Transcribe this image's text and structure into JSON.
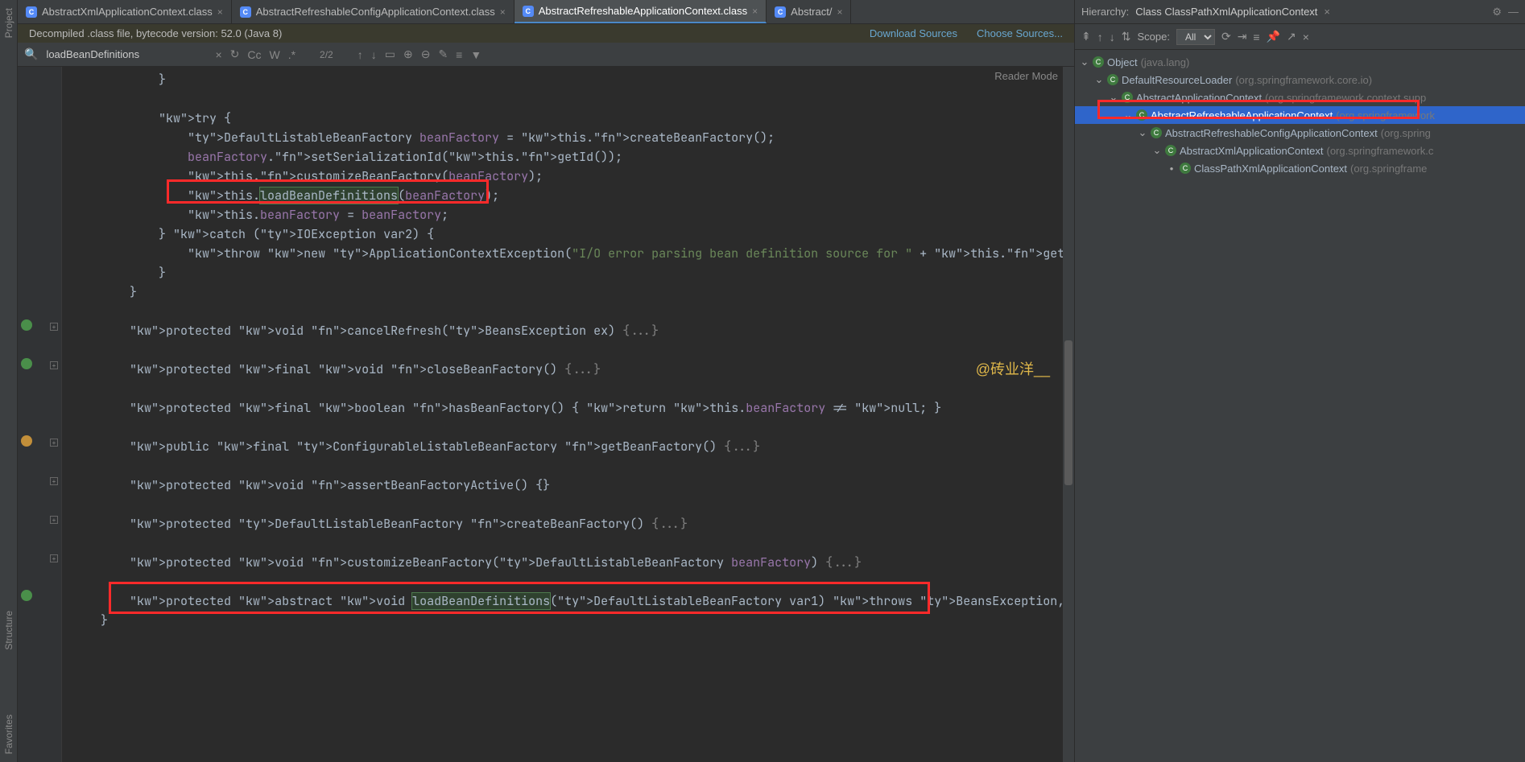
{
  "tabs": [
    {
      "label": "AbstractXmlApplicationContext.class",
      "active": false
    },
    {
      "label": "AbstractRefreshableConfigApplicationContext.class",
      "active": false
    },
    {
      "label": "AbstractRefreshableApplicationContext.class",
      "active": true
    },
    {
      "label": "Abstract/",
      "active": false
    }
  ],
  "banner": {
    "text": "Decompiled .class file, bytecode version: 52.0 (Java 8)",
    "link_download": "Download Sources",
    "link_choose": "Choose Sources..."
  },
  "find": {
    "value": "loadBeanDefinitions",
    "count": "2/2",
    "opts": {
      "cc": "Cc",
      "w": "W",
      "regex": ".*"
    }
  },
  "reader_mode": "Reader Mode",
  "watermark": "@砖业洋__",
  "code_lines": [
    "            }",
    "",
    "            try {",
    "                DefaultListableBeanFactory beanFactory = this.createBeanFactory();",
    "                beanFactory.setSerializationId(this.getId());",
    "                this.customizeBeanFactory(beanFactory);",
    "                this.loadBeanDefinitions(beanFactory);",
    "                this.beanFactory = beanFactory;",
    "            } catch (IOException var2) {",
    "                throw new ApplicationContextException(\"I/O error parsing bean definition source for \" + this.getDispl",
    "            }",
    "        }",
    "",
    "        protected void cancelRefresh(BeansException ex) {...}",
    "",
    "        protected final void closeBeanFactory() {...}",
    "",
    "        protected final boolean hasBeanFactory() { return this.beanFactory != null; }",
    "",
    "        public final ConfigurableListableBeanFactory getBeanFactory() {...}",
    "",
    "        protected void assertBeanFactoryActive() {}",
    "",
    "        protected DefaultListableBeanFactory createBeanFactory() {...}",
    "",
    "        protected void customizeBeanFactory(DefaultListableBeanFactory beanFactory) {...}",
    "",
    "        protected abstract void loadBeanDefinitions(DefaultListableBeanFactory var1) throws BeansException, IOExcepti",
    "    }"
  ],
  "hierarchy": {
    "title": "Hierarchy:",
    "class": "Class ClassPathXmlApplicationContext",
    "scope_label": "Scope:",
    "scope_value": "All",
    "tree": [
      {
        "indent": 0,
        "name": "Object",
        "pkg": "(java.lang)",
        "selected": false
      },
      {
        "indent": 1,
        "name": "DefaultResourceLoader",
        "pkg": "(org.springframework.core.io)",
        "selected": false
      },
      {
        "indent": 2,
        "name": "AbstractApplicationContext",
        "pkg": "(org.springframework.context.supp",
        "selected": false
      },
      {
        "indent": 3,
        "name": "AbstractRefreshableApplicationContext",
        "pkg": "(org.springframework",
        "selected": true
      },
      {
        "indent": 4,
        "name": "AbstractRefreshableConfigApplicationContext",
        "pkg": "(org.spring",
        "selected": false
      },
      {
        "indent": 5,
        "name": "AbstractXmlApplicationContext",
        "pkg": "(org.springframework.c",
        "selected": false
      },
      {
        "indent": 6,
        "name": "ClassPathXmlApplicationContext",
        "pkg": "(org.springframe",
        "selected": false,
        "leaf": true
      }
    ]
  },
  "rails": {
    "top": "Project",
    "mid": "Structure",
    "bot": "Favorites"
  }
}
